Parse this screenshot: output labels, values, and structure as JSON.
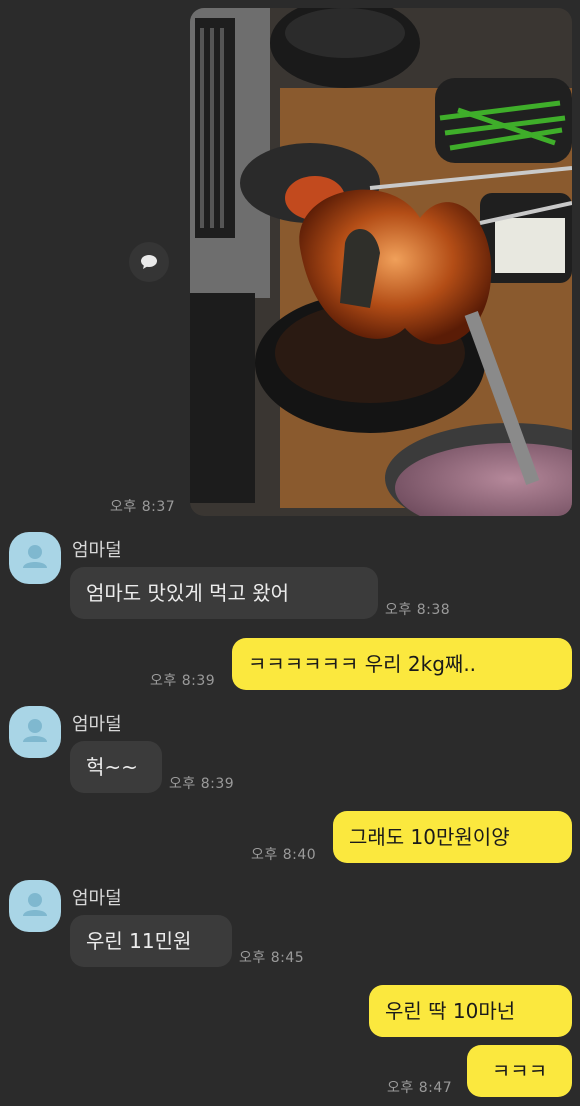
{
  "sender_name": "엄마덜",
  "messages": [
    {
      "kind": "photo",
      "time": "오후 8:37",
      "side": "out",
      "icon": "food-photo"
    },
    {
      "kind": "text",
      "side": "in",
      "text": "엄마도 맛있게 먹고 왔어",
      "time": "오후 8:38"
    },
    {
      "kind": "text",
      "side": "out",
      "text": "ㅋㅋㅋㅋㅋㅋ 우리 2kg째..",
      "time": "오후 8:39"
    },
    {
      "kind": "text",
      "side": "in",
      "text": "헉~~",
      "time": "오후 8:39"
    },
    {
      "kind": "text",
      "side": "out",
      "text": "그래도 10만원이양",
      "time": "오후 8:40"
    },
    {
      "kind": "text",
      "side": "in",
      "text": "우린 11민원",
      "time": "오후 8:45"
    },
    {
      "kind": "text",
      "side": "out",
      "text": "우린 딱 10마넌",
      "time": ""
    },
    {
      "kind": "text",
      "side": "out",
      "text": "ㅋㅋㅋ",
      "time": "오후 8:47"
    }
  ],
  "icons": {
    "share": "speech-bubble-icon",
    "avatar": "default-profile-icon"
  },
  "colors": {
    "background": "#2b2b2b",
    "incoming_bubble": "#3b3b3b",
    "outgoing_bubble": "#fbe83e",
    "avatar": "#a9d5e6"
  }
}
